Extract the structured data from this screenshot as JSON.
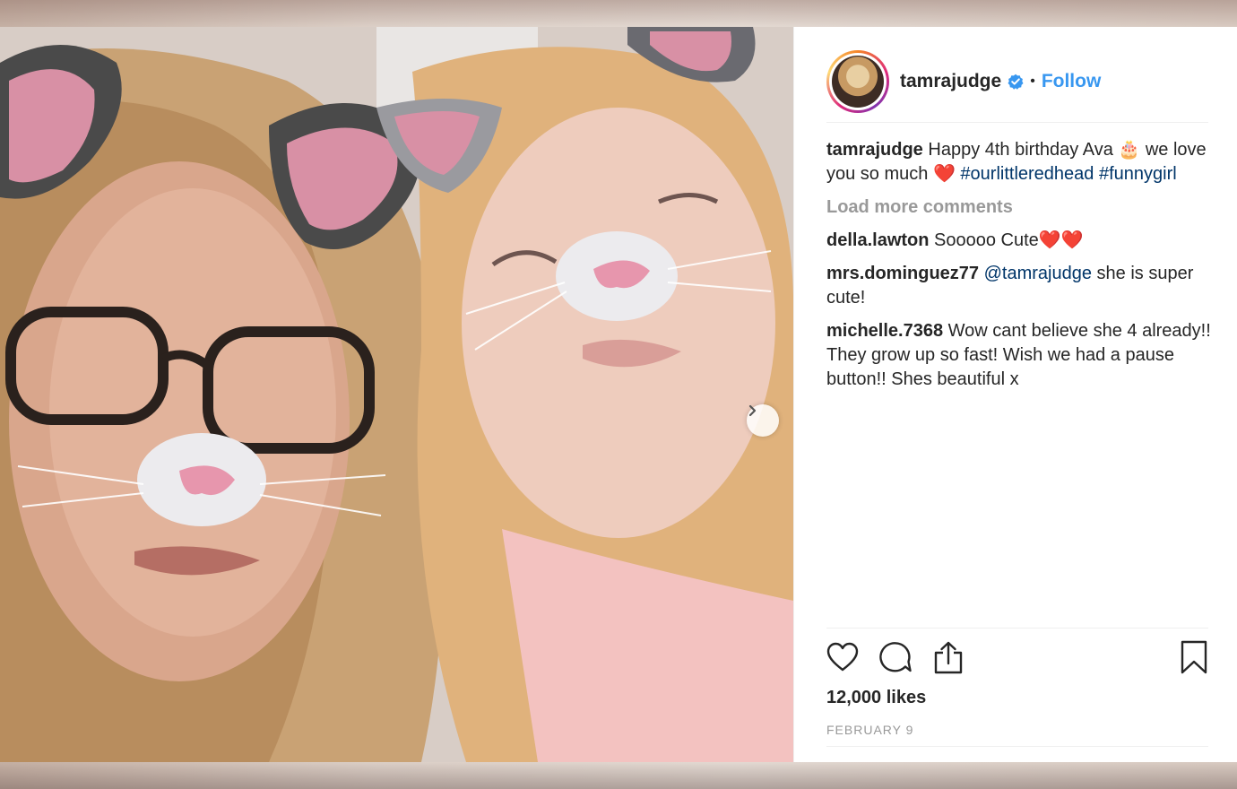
{
  "post": {
    "username": "tamrajudge",
    "separator": "•",
    "follow_label": "Follow",
    "caption": {
      "username": "tamrajudge",
      "text": "Happy 4th birthday Ava 🎂 we love you so much ❤️",
      "hashtags": [
        "#ourlittleredhead",
        "#funnygirl"
      ]
    },
    "load_more_label": "Load more comments",
    "comments": [
      {
        "username": "della.lawton",
        "mention": "",
        "text": "Sooooo Cute❤️❤️"
      },
      {
        "username": "mrs.dominguez77",
        "mention": "@tamrajudge",
        "text": "she is super cute!"
      },
      {
        "username": "michelle.7368",
        "mention": "",
        "text": "Wow cant believe she 4 already!! They grow up so fast! Wish we had a pause button!! Shes beautiful x"
      }
    ],
    "likes": "12,000 likes",
    "date": "FEBRUARY 9"
  },
  "icons": {
    "like": "heart-icon",
    "comment": "comment-bubble-icon",
    "share": "share-icon",
    "save": "bookmark-icon",
    "next": "chevron-right-icon",
    "verified": "verified-badge-icon"
  },
  "colors": {
    "link": "#003569",
    "follow": "#3897f0",
    "verified": "#3897f0",
    "text": "#262626",
    "muted": "#999999"
  }
}
